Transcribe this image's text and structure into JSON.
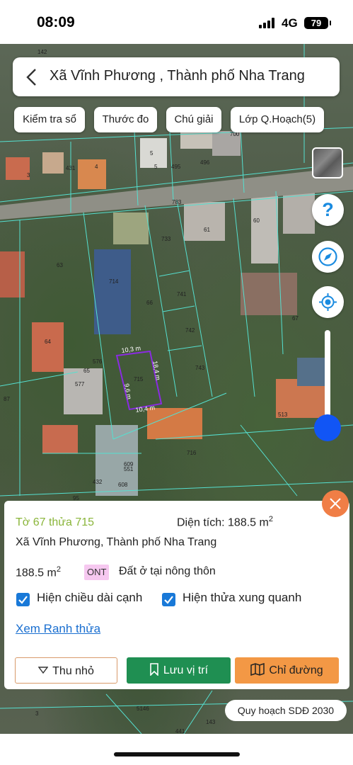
{
  "status_bar": {
    "time": "08:09",
    "network": "4G",
    "battery": "79"
  },
  "header": {
    "title": "Xã Vĩnh Phương , Thành phố Nha Trang"
  },
  "chips": [
    "Kiểm tra sổ",
    "Thước đo",
    "Chú giải",
    "Lớp Q.Hoạch(5)"
  ],
  "map": {
    "parcel_numbers": [
      "142",
      "700",
      "431",
      "4",
      "3",
      "495",
      "496",
      "783",
      "60",
      "61",
      "733",
      "63",
      "714",
      "66",
      "741",
      "742",
      "743",
      "67",
      "64",
      "576",
      "65",
      "577",
      "715",
      "87",
      "513",
      "716",
      "609",
      "551",
      "432",
      "608",
      "95",
      "5146",
      "441",
      "143",
      "3",
      "5",
      "5"
    ],
    "edge_labels": [
      "10,3 m",
      "9,6 m",
      "18,4 m",
      "10,4 m"
    ]
  },
  "parcel_info": {
    "sheet_parcel": "Tờ 67 thửa 715",
    "area_label": "Diện tích: 188.5 m",
    "area_unit_sup": "2",
    "address": "Xã Vĩnh Phương, Thành phố Nha Trang",
    "size": "188.5 m",
    "size_sup": "2",
    "land_code": "ONT",
    "land_type": "Đất ở tại nông thôn",
    "show_edge_lengths": "Hiện chiều dài cạnh",
    "show_surrounding": "Hiện thửa xung quanh",
    "view_boundary": "Xem Ranh thửa"
  },
  "actions": {
    "collapse": "Thu nhỏ",
    "save": "Lưu vị trí",
    "directions": "Chỉ đường"
  },
  "plan_badge": "Quy hoạch SDĐ 2030",
  "colors": {
    "accent_blue": "#1155f5",
    "green_button": "#1f8f52",
    "orange_button": "#f39845",
    "close_orange": "#f07e46",
    "parcel_outline": "#8a2be2",
    "boundary_lines": "#55e0d0"
  }
}
